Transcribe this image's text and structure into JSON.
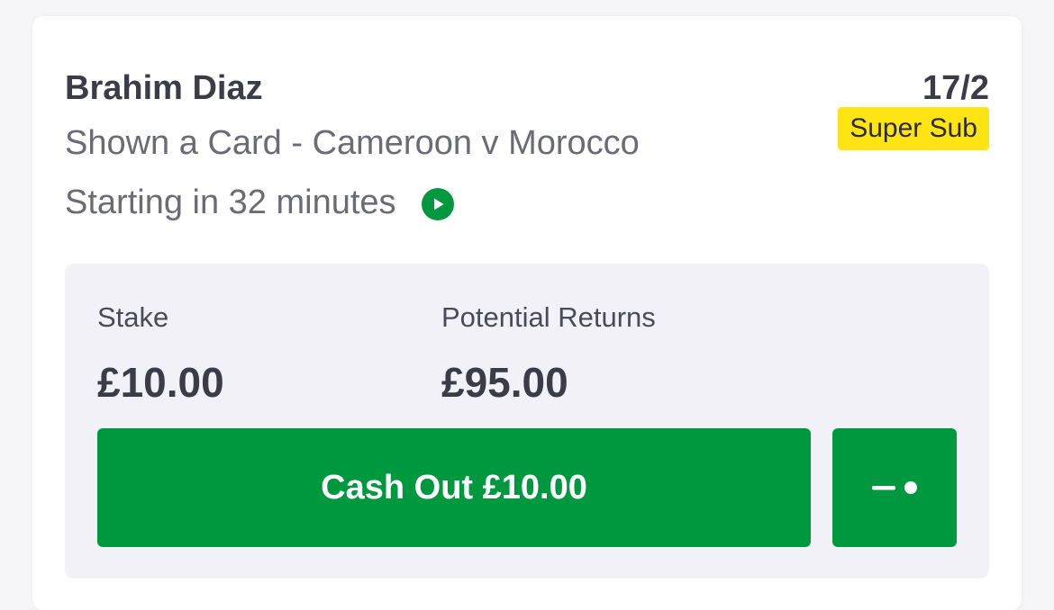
{
  "bet": {
    "selection": "Brahim Diaz",
    "odds": "17/2",
    "market": "Shown a Card - Cameroon v Morocco",
    "badge": "Super Sub",
    "start_status": "Starting in 32 minutes"
  },
  "panel": {
    "stake_label": "Stake",
    "stake_value": "£10.00",
    "returns_label": "Potential Returns",
    "returns_value": "£95.00",
    "cashout_label": "Cash Out £10.00"
  },
  "icons": {
    "play": "play-circle-icon",
    "partial": "slider-toggle-icon"
  },
  "colors": {
    "accent_green": "#00983f",
    "badge_yellow": "#ffe414",
    "text_dark": "#3c3c48",
    "text_muted": "#6b6b77",
    "panel_bg": "#f1f1f7"
  }
}
